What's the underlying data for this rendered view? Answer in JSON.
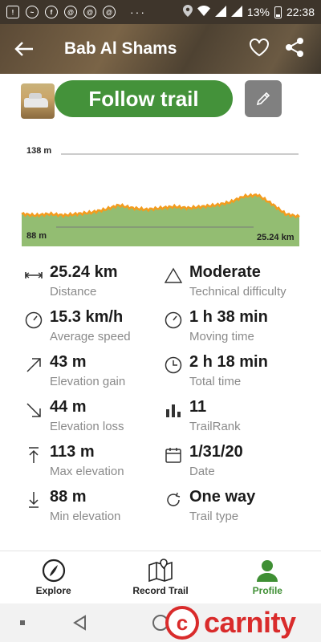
{
  "status_bar": {
    "battery": "13%",
    "time": "22:38"
  },
  "header": {
    "title": "Bab Al Shams"
  },
  "actions": {
    "follow_label": "Follow trail"
  },
  "chart": {
    "max_label": "138 m",
    "min_label": "88 m",
    "distance_label": "25.24 km"
  },
  "chart_data": {
    "type": "area",
    "xlabel": "",
    "ylabel": "",
    "x": [
      0,
      1.26,
      2.52,
      3.79,
      5.05,
      6.31,
      7.57,
      8.83,
      10.1,
      11.36,
      12.62,
      13.88,
      15.14,
      16.41,
      17.67,
      18.93,
      20.19,
      21.45,
      22.72,
      23.98,
      25.24
    ],
    "values": [
      97,
      96,
      97,
      96,
      97,
      98,
      100,
      103,
      101,
      100,
      101,
      102,
      101,
      102,
      103,
      105,
      109,
      110,
      104,
      97,
      95
    ],
    "ylim": [
      88,
      138
    ],
    "xlim": [
      0,
      25.24
    ],
    "colors": {
      "line": "#f39c1e",
      "fill": "#93bd72"
    }
  },
  "stats": [
    {
      "value": "25.24 km",
      "label": "Distance",
      "icon": "distance-icon"
    },
    {
      "value": "Moderate",
      "label": "Technical difficulty",
      "icon": "difficulty-icon"
    },
    {
      "value": "15.3 km/h",
      "label": "Average speed",
      "icon": "speedometer-icon"
    },
    {
      "value": "1 h 38 min",
      "label": "Moving time",
      "icon": "speedometer-icon"
    },
    {
      "value": "43 m",
      "label": "Elevation gain",
      "icon": "arrow-up-right-icon"
    },
    {
      "value": "2 h 18 min",
      "label": "Total time",
      "icon": "clock-icon"
    },
    {
      "value": "44 m",
      "label": "Elevation loss",
      "icon": "arrow-down-right-icon"
    },
    {
      "value": "11",
      "label": "TrailRank",
      "icon": "bar-chart-icon"
    },
    {
      "value": "113 m",
      "label": "Max elevation",
      "icon": "max-elevation-icon"
    },
    {
      "value": "1/31/20",
      "label": "Date",
      "icon": "calendar-icon"
    },
    {
      "value": "88 m",
      "label": "Min elevation",
      "icon": "min-elevation-icon"
    },
    {
      "value": "One way",
      "label": "Trail type",
      "icon": "one-way-icon"
    }
  ],
  "bottom_nav": {
    "explore": "Explore",
    "record": "Record Trail",
    "profile": "Profile"
  },
  "watermark": {
    "text": "carnity"
  },
  "colors": {
    "accent": "#44923a",
    "header": "#5b4a36",
    "chart_line": "#f39c1e",
    "chart_fill": "#93bd72"
  }
}
